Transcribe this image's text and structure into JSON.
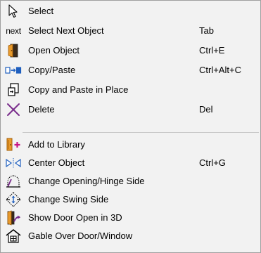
{
  "menu": {
    "items": [
      {
        "label": "Select",
        "shortcut": "",
        "icon": "pointer-arrow-icon"
      },
      {
        "label": "Select Next Object",
        "shortcut": "Tab",
        "icon": "next-text-icon",
        "icon_text": "next"
      },
      {
        "label": "Open Object",
        "shortcut": "Ctrl+E",
        "icon": "open-door-icon"
      },
      {
        "label": "Copy/Paste",
        "shortcut": "Ctrl+Alt+C",
        "icon": "copy-paste-icon"
      },
      {
        "label": "Copy and Paste in Place",
        "shortcut": "",
        "icon": "paste-in-place-icon"
      },
      {
        "label": "Delete",
        "shortcut": "Del",
        "icon": "delete-x-icon"
      },
      {
        "label": "Add to Library",
        "shortcut": "",
        "icon": "add-to-library-icon"
      },
      {
        "label": "Center Object",
        "shortcut": "Ctrl+G",
        "icon": "center-object-icon"
      },
      {
        "label": "Change Opening/Hinge Side",
        "shortcut": "",
        "icon": "hinge-side-icon"
      },
      {
        "label": "Change Swing Side",
        "shortcut": "",
        "icon": "swing-side-icon"
      },
      {
        "label": "Show Door Open in 3D",
        "shortcut": "",
        "icon": "door-open-3d-icon"
      },
      {
        "label": "Gable Over Door/Window",
        "shortcut": "",
        "icon": "gable-icon"
      }
    ]
  },
  "colors": {
    "background": "#f2f2f2",
    "border": "#a0a0a0",
    "separator": "#c8c8c8",
    "delete_x": "#7a2e8c",
    "door_orange": "#d98a1c",
    "blue_icon": "#1f5fbf",
    "add_plus": "#c71585"
  }
}
